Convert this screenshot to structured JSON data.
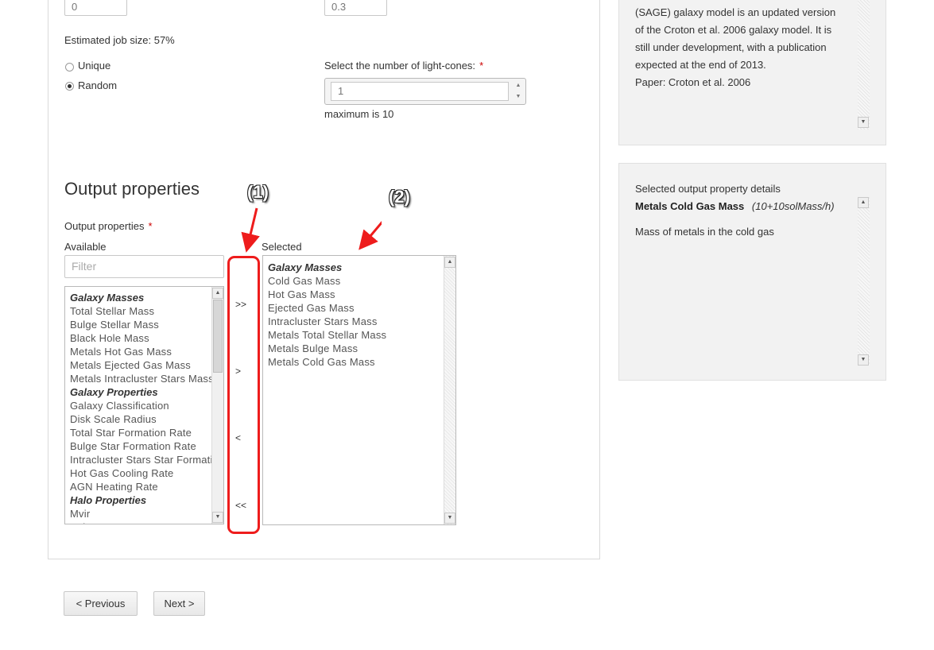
{
  "top_fields": {
    "left_value": "0",
    "right_value": "0.3"
  },
  "job_size": "Estimated job size: 57%",
  "radio": {
    "unique": "Unique",
    "random": "Random"
  },
  "lightcones": {
    "label": "Select the number of light-cones:",
    "required": "*",
    "value": "1",
    "hint": "maximum is 10"
  },
  "output": {
    "heading": "Output properties",
    "field_label": "Output properties",
    "required": "*",
    "available_label": "Available",
    "filter_placeholder": "Filter",
    "selected_label": "Selected",
    "available_items": [
      {
        "text": "Galaxy Masses",
        "group": true
      },
      {
        "text": "Total Stellar Mass",
        "group": false
      },
      {
        "text": "Bulge Stellar Mass",
        "group": false
      },
      {
        "text": "Black Hole Mass",
        "group": false
      },
      {
        "text": "Metals Hot Gas Mass",
        "group": false
      },
      {
        "text": "Metals Ejected Gas Mass",
        "group": false
      },
      {
        "text": "Metals Intracluster Stars Mass",
        "group": false
      },
      {
        "text": "Galaxy Properties",
        "group": true
      },
      {
        "text": "Galaxy Classification",
        "group": false
      },
      {
        "text": "Disk Scale Radius",
        "group": false
      },
      {
        "text": "Total Star Formation Rate",
        "group": false
      },
      {
        "text": "Bulge Star Formation Rate",
        "group": false
      },
      {
        "text": "Intracluster Stars Star Formation Rate",
        "group": false
      },
      {
        "text": "Hot Gas Cooling Rate",
        "group": false
      },
      {
        "text": "AGN Heating Rate",
        "group": false
      },
      {
        "text": "Halo Properties",
        "group": true
      },
      {
        "text": "Mvir",
        "group": false
      },
      {
        "text": "Rvir",
        "group": false
      }
    ],
    "selected_items": [
      {
        "text": "Galaxy Masses",
        "group": true
      },
      {
        "text": "Cold Gas Mass",
        "group": false
      },
      {
        "text": "Hot Gas Mass",
        "group": false
      },
      {
        "text": "Ejected Gas Mass",
        "group": false
      },
      {
        "text": "Intracluster Stars Mass",
        "group": false
      },
      {
        "text": "Metals Total Stellar Mass",
        "group": false
      },
      {
        "text": "Metals Bulge Mass",
        "group": false
      },
      {
        "text": "Metals Cold Gas Mass",
        "group": false
      }
    ],
    "buttons": {
      "add_all": ">>",
      "add": ">",
      "remove": "<",
      "remove_all": "<<"
    }
  },
  "annotations": {
    "one": "(1)",
    "two": "(2)"
  },
  "model_panel": {
    "lines": [
      "(SAGE) galaxy model is an updated version",
      "of the Croton et al. 2006 galaxy model. It is",
      "still under development, with a publication",
      "expected at the end of 2013.",
      "Paper: Croton et al. 2006"
    ]
  },
  "detail_panel": {
    "title": "Selected output property details",
    "property_name": "Metals Cold Gas Mass",
    "property_unit": "(10+10solMass/h)",
    "description": "Mass of metals in the cold gas"
  },
  "nav": {
    "previous": "< Previous",
    "next": "Next >"
  },
  "colors": {
    "annotation_red": "#ee1c1c"
  }
}
